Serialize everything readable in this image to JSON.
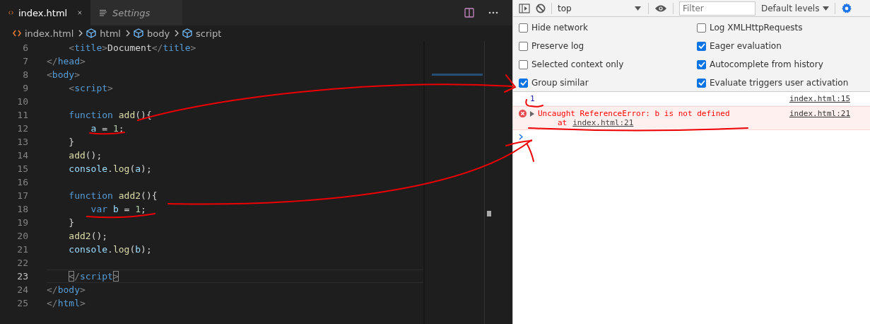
{
  "editor": {
    "tabs": [
      {
        "label": "index.html",
        "kind": "html",
        "selected": true,
        "preview": false
      },
      {
        "label": "Settings",
        "kind": "settings",
        "selected": false,
        "preview": true
      }
    ],
    "breadcrumbs": [
      {
        "label": "index.html",
        "kind": "file"
      },
      {
        "label": "html",
        "kind": "element"
      },
      {
        "label": "body",
        "kind": "element"
      },
      {
        "label": "script",
        "kind": "element"
      }
    ],
    "lines": [
      {
        "number": "6",
        "current": false,
        "tokens": [
          {
            "kind": "bracket",
            "text": "    <"
          },
          {
            "kind": "tag",
            "text": "title"
          },
          {
            "kind": "bracket",
            "text": ">"
          },
          {
            "kind": "text",
            "text": "Document"
          },
          {
            "kind": "bracket",
            "text": "</"
          },
          {
            "kind": "tag",
            "text": "title"
          },
          {
            "kind": "bracket",
            "text": ">"
          }
        ]
      },
      {
        "number": "7",
        "current": false,
        "tokens": [
          {
            "kind": "bracket",
            "text": "</"
          },
          {
            "kind": "tag",
            "text": "head"
          },
          {
            "kind": "bracket",
            "text": ">"
          }
        ]
      },
      {
        "number": "8",
        "current": false,
        "tokens": [
          {
            "kind": "bracket",
            "text": "<"
          },
          {
            "kind": "tag",
            "text": "body"
          },
          {
            "kind": "bracket",
            "text": ">"
          }
        ]
      },
      {
        "number": "9",
        "current": false,
        "tokens": [
          {
            "kind": "bracket",
            "text": "    <"
          },
          {
            "kind": "tag",
            "text": "script"
          },
          {
            "kind": "bracket",
            "text": ">"
          }
        ]
      },
      {
        "number": "10",
        "current": false
      },
      {
        "number": "11",
        "current": false,
        "tokens": [
          {
            "kind": "keyword",
            "text": "    function "
          },
          {
            "kind": "function",
            "text": "add"
          },
          {
            "kind": "punct",
            "text": "(){"
          }
        ]
      },
      {
        "number": "12",
        "current": false,
        "tokens": [
          {
            "kind": "variable",
            "text": "        a"
          },
          {
            "kind": "punct",
            "text": " = "
          },
          {
            "kind": "number",
            "text": "1"
          },
          {
            "kind": "punct",
            "text": ";"
          }
        ]
      },
      {
        "number": "13",
        "current": false,
        "tokens": [
          {
            "kind": "punct",
            "text": "    }"
          }
        ]
      },
      {
        "number": "14",
        "current": false,
        "tokens": [
          {
            "kind": "function",
            "text": "    add"
          },
          {
            "kind": "punct",
            "text": "();"
          }
        ]
      },
      {
        "number": "15",
        "current": false,
        "tokens": [
          {
            "kind": "variable",
            "text": "    console"
          },
          {
            "kind": "punct",
            "text": "."
          },
          {
            "kind": "function",
            "text": "log"
          },
          {
            "kind": "punct",
            "text": "("
          },
          {
            "kind": "variable",
            "text": "a"
          },
          {
            "kind": "punct",
            "text": ");"
          }
        ]
      },
      {
        "number": "16",
        "current": false
      },
      {
        "number": "17",
        "current": false,
        "tokens": [
          {
            "kind": "keyword",
            "text": "    function "
          },
          {
            "kind": "function",
            "text": "add2"
          },
          {
            "kind": "punct",
            "text": "(){"
          }
        ]
      },
      {
        "number": "18",
        "current": false,
        "tokens": [
          {
            "kind": "keyword",
            "text": "        var "
          },
          {
            "kind": "variable",
            "text": "b"
          },
          {
            "kind": "punct",
            "text": " = "
          },
          {
            "kind": "number",
            "text": "1"
          },
          {
            "kind": "punct",
            "text": ";"
          }
        ]
      },
      {
        "number": "19",
        "current": false,
        "tokens": [
          {
            "kind": "punct",
            "text": "    }"
          }
        ]
      },
      {
        "number": "20",
        "current": false,
        "tokens": [
          {
            "kind": "function",
            "text": "    add2"
          },
          {
            "kind": "punct",
            "text": "();"
          }
        ]
      },
      {
        "number": "21",
        "current": false,
        "tokens": [
          {
            "kind": "variable",
            "text": "    console"
          },
          {
            "kind": "punct",
            "text": "."
          },
          {
            "kind": "function",
            "text": "log"
          },
          {
            "kind": "punct",
            "text": "("
          },
          {
            "kind": "variable",
            "text": "b"
          },
          {
            "kind": "punct",
            "text": ");"
          }
        ]
      },
      {
        "number": "22",
        "current": false
      },
      {
        "number": "23",
        "current": true,
        "tokens": [
          {
            "kind": "match",
            "text": "<"
          },
          {
            "kind": "bracket",
            "text": "/"
          },
          {
            "kind": "tag",
            "text": "script"
          },
          {
            "kind": "match",
            "text": ">"
          }
        ]
      },
      {
        "number": "24",
        "current": false,
        "tokens": [
          {
            "kind": "bracket",
            "text": "</"
          },
          {
            "kind": "tag",
            "text": "body"
          },
          {
            "kind": "bracket",
            "text": ">"
          }
        ]
      },
      {
        "number": "25",
        "current": false,
        "tokens": [
          {
            "kind": "bracket",
            "text": "</"
          },
          {
            "kind": "tag",
            "text": "html"
          },
          {
            "kind": "bracket",
            "text": ">"
          }
        ]
      }
    ]
  },
  "devtools": {
    "context": "top",
    "filter": {
      "placeholder": "Filter"
    },
    "levels": "Default levels",
    "settings": [
      {
        "label": "Hide network",
        "checked": false
      },
      {
        "label": "Log XMLHttpRequests",
        "checked": false
      },
      {
        "label": "Preserve log",
        "checked": false
      },
      {
        "label": "Eager evaluation",
        "checked": true
      },
      {
        "label": "Selected context only",
        "checked": false
      },
      {
        "label": "Autocomplete from history",
        "checked": true
      },
      {
        "label": "Group similar",
        "checked": true
      },
      {
        "label": "Evaluate triggers user activation",
        "checked": true
      }
    ],
    "messages": [
      {
        "kind": "log",
        "text": "1",
        "source": "index.html:15"
      },
      {
        "kind": "error",
        "text": "Uncaught ReferenceError: b is not defined",
        "stack_prefix": "at",
        "stack_link": "index.html:21",
        "source": "index.html:21"
      }
    ]
  }
}
